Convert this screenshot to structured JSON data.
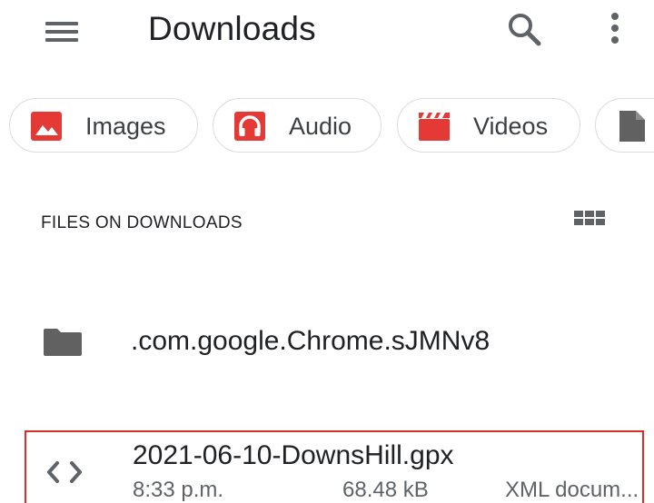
{
  "app_bar": {
    "menu_icon": "hamburger-menu-icon",
    "title": "Downloads",
    "search_icon": "search-icon",
    "more_icon": "more-vertical-icon"
  },
  "chips": [
    {
      "label": "Images",
      "icon": "image-icon",
      "icon_color": "#e53935"
    },
    {
      "label": "Audio",
      "icon": "headphones-icon",
      "icon_color": "#e53935"
    },
    {
      "label": "Videos",
      "icon": "clapperboard-icon",
      "icon_color": "#e53935"
    },
    {
      "label": "",
      "icon": "document-icon",
      "icon_color": "#616161"
    }
  ],
  "section": {
    "title": "FILES ON DOWNLOADS",
    "view_toggle_icon": "grid-view-icon"
  },
  "files": [
    {
      "type": "folder",
      "icon": "folder-icon",
      "name": ".com.google.Chrome.sJMNv8"
    },
    {
      "type": "file",
      "icon": "code-icon",
      "name": "2021-06-10-DownsHill.gpx",
      "time": "8:33 p.m.",
      "size": "68.48 kB",
      "kind": "XML docum..."
    }
  ],
  "colors": {
    "accent_red": "#e53935",
    "icon_gray": "#5f6368",
    "selection_border": "#d93025",
    "text_primary": "#202124",
    "text_secondary": "#5f6368"
  }
}
